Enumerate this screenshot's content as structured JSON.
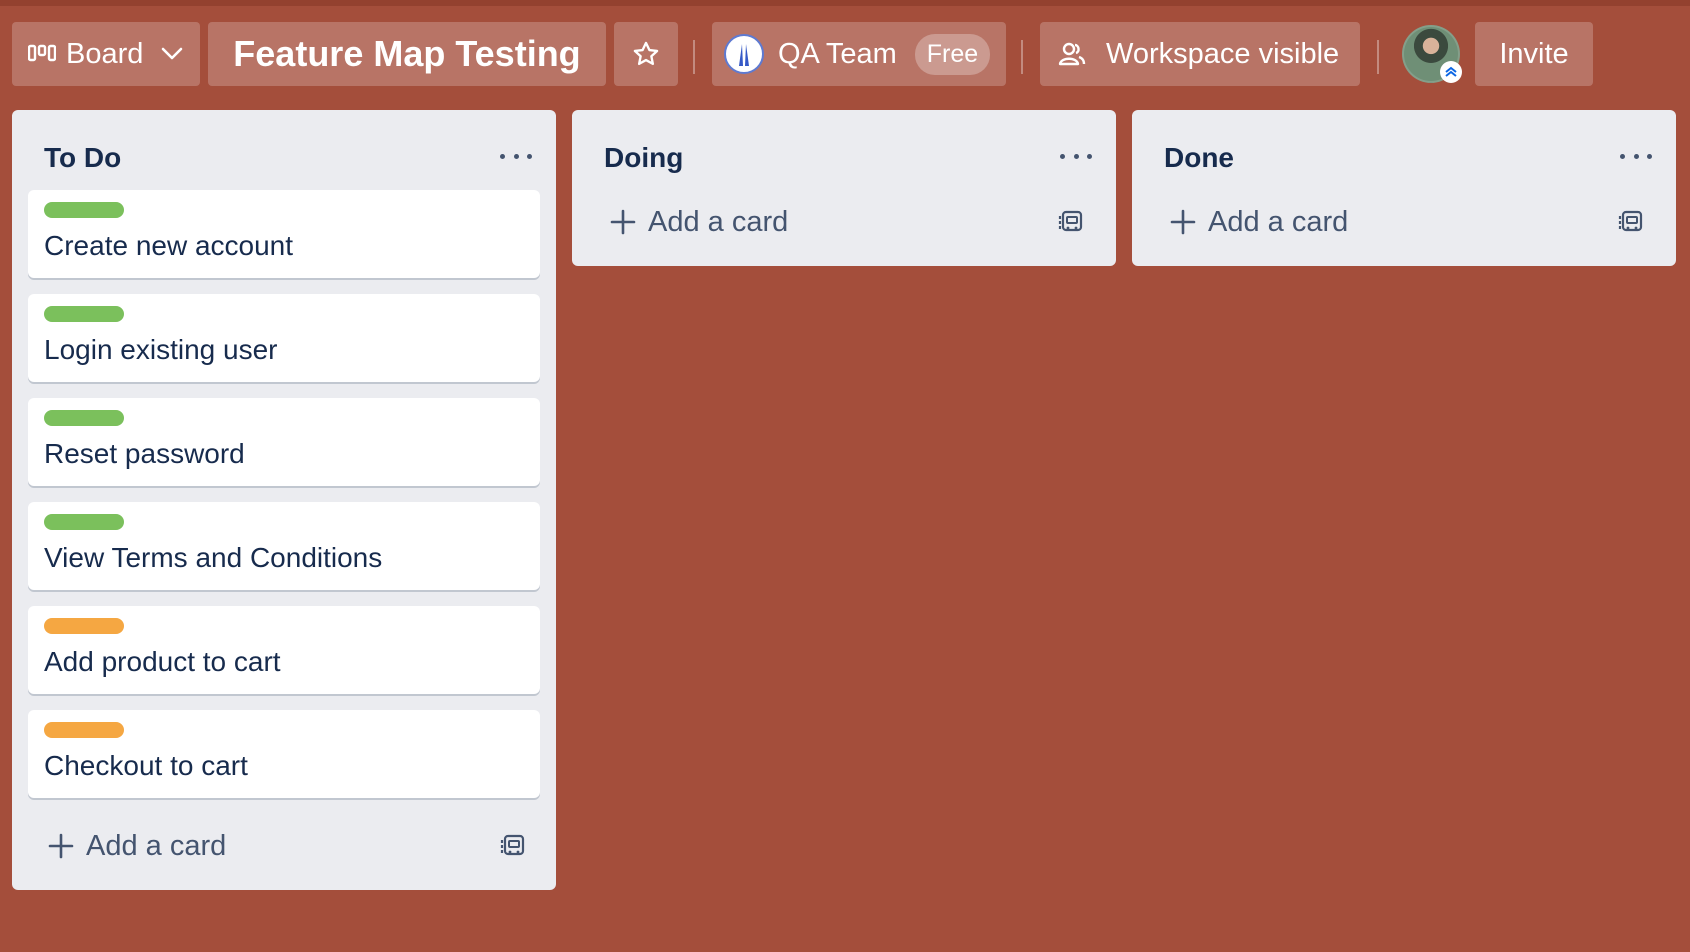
{
  "header": {
    "view_label": "Board",
    "board_title": "Feature Map Testing",
    "workspace_name": "QA Team",
    "workspace_plan": "Free",
    "visibility_label": "Workspace visible",
    "invite_label": "Invite"
  },
  "colors": {
    "background": "#a44e3b",
    "label_green": "#7bc05c",
    "label_orange": "#f5a742"
  },
  "lists": [
    {
      "title": "To Do",
      "cards": [
        {
          "label_color": "green",
          "text": "Create new account"
        },
        {
          "label_color": "green",
          "text": "Login existing user"
        },
        {
          "label_color": "green",
          "text": "Reset password"
        },
        {
          "label_color": "green",
          "text": "View Terms and Conditions"
        },
        {
          "label_color": "orange",
          "text": "Add product to cart"
        },
        {
          "label_color": "orange",
          "text": "Checkout to cart"
        }
      ],
      "add_card_label": "Add a card"
    },
    {
      "title": "Doing",
      "cards": [],
      "add_card_label": "Add a card"
    },
    {
      "title": "Done",
      "cards": [],
      "add_card_label": "Add a card"
    }
  ]
}
